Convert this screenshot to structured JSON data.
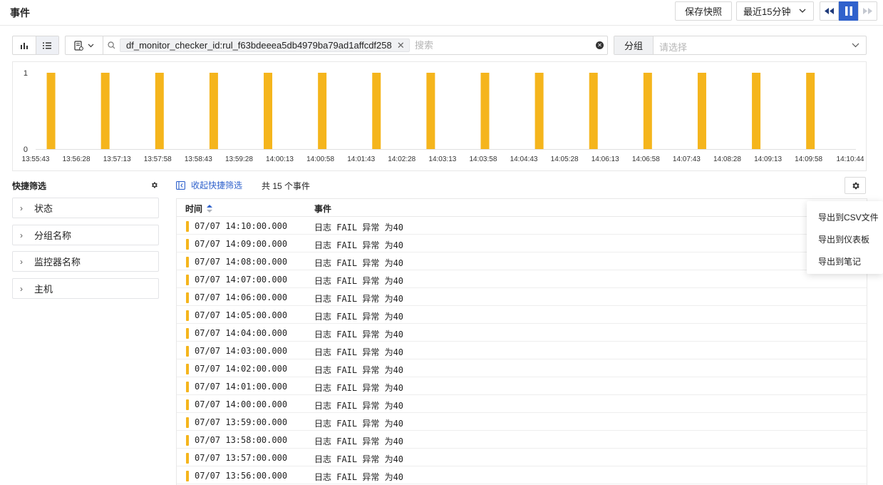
{
  "header": {
    "title": "事件",
    "save_snapshot_label": "保存快照",
    "time_range_label": "最近15分钟"
  },
  "search": {
    "tag": "df_monitor_checker_id:rul_f63bdeeea5db4979ba79ad1affcdf258",
    "placeholder": "搜索",
    "group_label": "分组",
    "group_placeholder": "请选择"
  },
  "chart_data": {
    "type": "bar",
    "categories": [
      "13:55:43",
      "13:56:28",
      "13:57:13",
      "13:57:58",
      "13:58:43",
      "13:59:28",
      "14:00:13",
      "14:00:58",
      "14:01:43",
      "14:02:28",
      "14:03:13",
      "14:03:58",
      "14:04:43",
      "14:05:28",
      "14:06:13",
      "14:06:58",
      "14:07:43",
      "14:08:28",
      "14:09:13",
      "14:09:58",
      "14:10:44"
    ],
    "series": [
      {
        "x": [
          "13:56:00",
          "13:57:00",
          "13:58:00",
          "13:59:00",
          "14:00:00",
          "14:01:00",
          "14:02:00",
          "14:03:00",
          "14:04:00",
          "14:05:00",
          "14:06:00",
          "14:07:00",
          "14:08:00",
          "14:09:00",
          "14:10:00"
        ],
        "values": [
          1,
          1,
          1,
          1,
          1,
          1,
          1,
          1,
          1,
          1,
          1,
          1,
          1,
          1,
          1
        ]
      }
    ],
    "ylim": [
      0,
      1
    ],
    "yticks": [
      "0",
      "1"
    ],
    "color": "#f5b51c",
    "grid": false,
    "title": "",
    "xlabel": "",
    "ylabel": ""
  },
  "quick_filter": {
    "title": "快捷筛选",
    "items": [
      "状态",
      "分组名称",
      "监控器名称",
      "主机"
    ]
  },
  "results": {
    "collapse_label": "收起快捷筛选",
    "count_label": "共 15 个事件",
    "columns": {
      "time": "时间",
      "event": "事件"
    },
    "rows": [
      {
        "time": "07/07 14:10:00.000",
        "event": "日志 FAIL 异常 为40"
      },
      {
        "time": "07/07 14:09:00.000",
        "event": "日志 FAIL 异常 为40"
      },
      {
        "time": "07/07 14:08:00.000",
        "event": "日志 FAIL 异常 为40"
      },
      {
        "time": "07/07 14:07:00.000",
        "event": "日志 FAIL 异常 为40"
      },
      {
        "time": "07/07 14:06:00.000",
        "event": "日志 FAIL 异常 为40"
      },
      {
        "time": "07/07 14:05:00.000",
        "event": "日志 FAIL 异常 为40"
      },
      {
        "time": "07/07 14:04:00.000",
        "event": "日志 FAIL 异常 为40"
      },
      {
        "time": "07/07 14:03:00.000",
        "event": "日志 FAIL 异常 为40"
      },
      {
        "time": "07/07 14:02:00.000",
        "event": "日志 FAIL 异常 为40"
      },
      {
        "time": "07/07 14:01:00.000",
        "event": "日志 FAIL 异常 为40"
      },
      {
        "time": "07/07 14:00:00.000",
        "event": "日志 FAIL 异常 为40"
      },
      {
        "time": "07/07 13:59:00.000",
        "event": "日志 FAIL 异常 为40"
      },
      {
        "time": "07/07 13:58:00.000",
        "event": "日志 FAIL 异常 为40"
      },
      {
        "time": "07/07 13:57:00.000",
        "event": "日志 FAIL 异常 为40"
      },
      {
        "time": "07/07 13:56:00.000",
        "event": "日志 FAIL 异常 为40"
      }
    ],
    "status_color": "#f5b51c"
  },
  "export_menu": {
    "items": [
      "导出到CSV文件",
      "导出到仪表板",
      "导出到笔记"
    ]
  },
  "colors": {
    "accent": "#2f61cc",
    "warning": "#f5b51c"
  }
}
